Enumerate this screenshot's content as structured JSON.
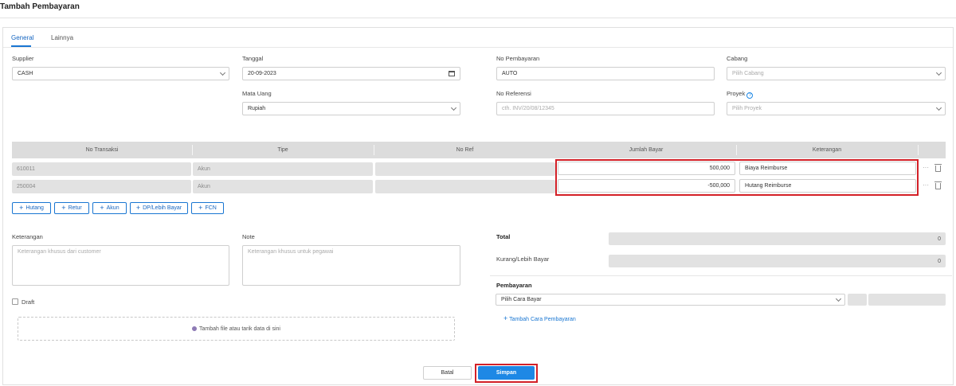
{
  "page": {
    "title": "Tambah Pembayaran"
  },
  "tabs": [
    {
      "label": "General"
    },
    {
      "label": "Lainnya"
    }
  ],
  "form": {
    "supplier": {
      "label": "Supplier",
      "value": "CASH"
    },
    "tanggal": {
      "label": "Tanggal",
      "value": "20-09-2023"
    },
    "no_pembayaran": {
      "label": "No Pembayaran",
      "value": "AUTO"
    },
    "cabang": {
      "label": "Cabang",
      "placeholder": "Pilih Cabang"
    },
    "mata_uang": {
      "label": "Mata Uang",
      "value": "Rupiah"
    },
    "no_referensi": {
      "label": "No Referensi",
      "placeholder": "cth. INV/20/08/12345"
    },
    "proyek": {
      "label": "Proyek",
      "placeholder": "Pilih Proyek",
      "help_icon": "question-circle-icon"
    }
  },
  "table": {
    "headers": [
      "No Transaksi",
      "Tipe",
      "No Ref",
      "Jumlah Bayar",
      "Keterangan"
    ],
    "rows": [
      {
        "no_transaksi": "610011",
        "tipe": "Akun",
        "no_ref": "",
        "jumlah": "500,000",
        "keterangan": "Biaya Reimburse"
      },
      {
        "no_transaksi": "250004",
        "tipe": "Akun",
        "no_ref": "",
        "jumlah": "-500,000",
        "keterangan": "Hutang Reimburse"
      }
    ],
    "row_icons": [
      "more-horizontal-icon",
      "trash-icon"
    ]
  },
  "add_buttons": [
    {
      "label": "Hutang"
    },
    {
      "label": "Retur"
    },
    {
      "label": "Akun"
    },
    {
      "label": "DP/Lebih Bayar"
    },
    {
      "label": "FCN"
    }
  ],
  "notes": {
    "keterangan": {
      "label": "Keterangan",
      "placeholder": "Keterangan khusus dari customer"
    },
    "note": {
      "label": "Note",
      "placeholder": "Keterangan khusus untuk pegawai"
    }
  },
  "draft": {
    "label": "Draft"
  },
  "upload": {
    "label": "Tambah file atau tarik data di sini",
    "icon": "paperclip-icon"
  },
  "summary": {
    "total": {
      "label": "Total",
      "value": "0"
    },
    "kurang": {
      "label": "Kurang/Lebih Bayar",
      "value": "0"
    }
  },
  "payment": {
    "label": "Pembayaran",
    "select_placeholder": "Pilih Cara Bayar",
    "add_label": "Tambah Cara Pembayaran"
  },
  "footer": {
    "cancel_label": "Batal",
    "save_label": "Simpan"
  },
  "colors": {
    "accent": "#1e88e5",
    "highlight": "#d32027"
  }
}
